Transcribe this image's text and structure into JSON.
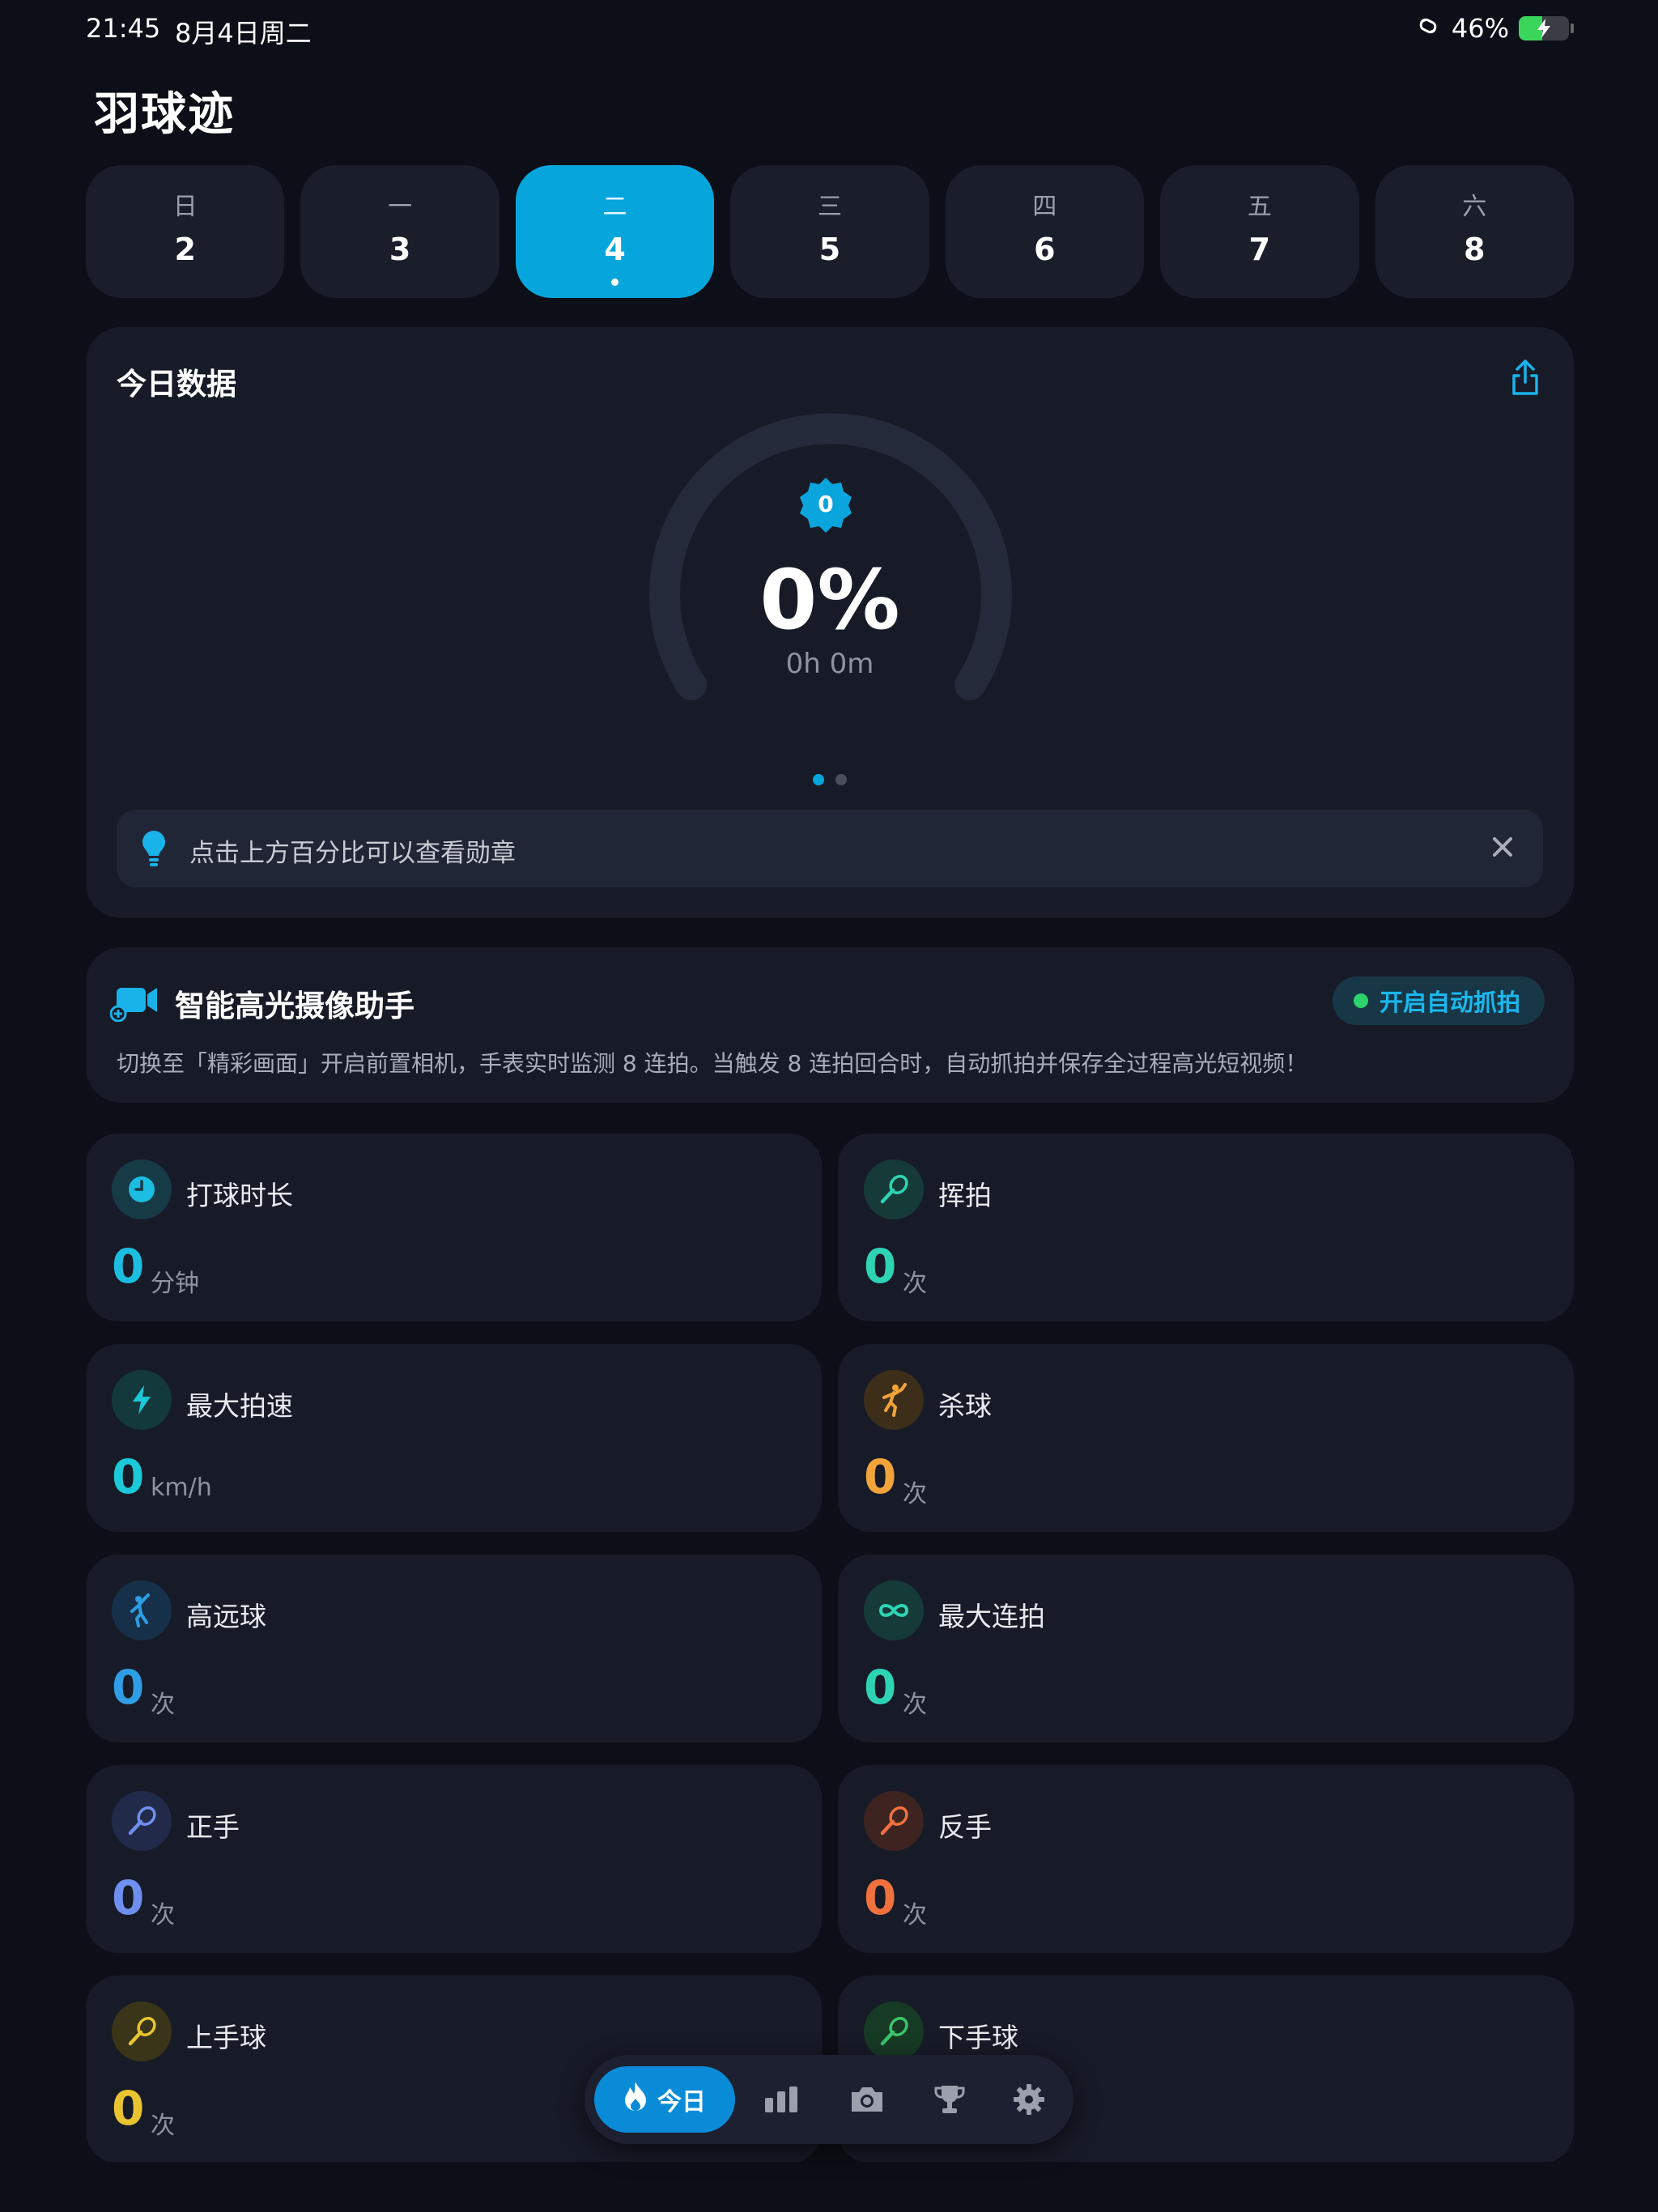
{
  "status_bar": {
    "time": "21:45",
    "date": "8月4日周二",
    "battery_percent": "46%",
    "battery_level": 0.46
  },
  "app": {
    "title": "羽球迹"
  },
  "week": {
    "days": [
      {
        "weekday": "日",
        "date": "2"
      },
      {
        "weekday": "一",
        "date": "3"
      },
      {
        "weekday": "二",
        "date": "4"
      },
      {
        "weekday": "三",
        "date": "5"
      },
      {
        "weekday": "四",
        "date": "6"
      },
      {
        "weekday": "五",
        "date": "7"
      },
      {
        "weekday": "六",
        "date": "8"
      }
    ],
    "selected_index": 2
  },
  "today": {
    "title": "今日数据",
    "badge_value": "0",
    "percent": "0%",
    "progress": 0,
    "duration": "0h 0m",
    "page_count": 2,
    "page_active": 0,
    "tip": "点击上方百分比可以查看勋章"
  },
  "camera": {
    "title": "智能高光摄像助手",
    "button": "开启自动抓拍",
    "description": "切换至「精彩画面」开启前置相机，手表实时监测 8 连拍。当触发 8 连拍回合时，自动抓拍并保存全过程高光短视频！"
  },
  "stats": [
    {
      "label": "打球时长",
      "value": "0",
      "unit": "分钟",
      "icon": "clock-icon",
      "color": "#1bbde0",
      "bg": "#163a46"
    },
    {
      "label": "挥拍",
      "value": "0",
      "unit": "次",
      "icon": "racket-icon",
      "color": "#2dd4b4",
      "bg": "#153a38"
    },
    {
      "label": "最大拍速",
      "value": "0",
      "unit": "km/h",
      "icon": "lightning-icon",
      "color": "#1bc9d8",
      "bg": "#14393d"
    },
    {
      "label": "杀球",
      "value": "0",
      "unit": "次",
      "icon": "smash-player-icon",
      "color": "#f2a43a",
      "bg": "#3d2e1a"
    },
    {
      "label": "高远球",
      "value": "0",
      "unit": "次",
      "icon": "clear-player-icon",
      "color": "#2e9de6",
      "bg": "#16304a"
    },
    {
      "label": "最大连拍",
      "value": "0",
      "unit": "次",
      "icon": "infinity-icon",
      "color": "#2dd4b4",
      "bg": "#153a38"
    },
    {
      "label": "正手",
      "value": "0",
      "unit": "次",
      "icon": "racket-icon",
      "color": "#6f8ff0",
      "bg": "#222a4a"
    },
    {
      "label": "反手",
      "value": "0",
      "unit": "次",
      "icon": "racket-icon",
      "color": "#f0713e",
      "bg": "#3d2420"
    },
    {
      "label": "上手球",
      "value": "0",
      "unit": "次",
      "icon": "racket-icon",
      "color": "#e8c530",
      "bg": "#3a3518"
    },
    {
      "label": "下手球",
      "value": "",
      "unit": "",
      "icon": "racket-icon",
      "color": "#3cc46a",
      "bg": "#173a25"
    }
  ],
  "nav": {
    "active_label": "今日",
    "items": [
      "flame-icon",
      "bar-chart-icon",
      "camera-icon",
      "trophy-icon",
      "gear-icon"
    ]
  },
  "colors": {
    "accent": "#06a6dd",
    "background": "#0c0f17",
    "card": "#171b27"
  }
}
